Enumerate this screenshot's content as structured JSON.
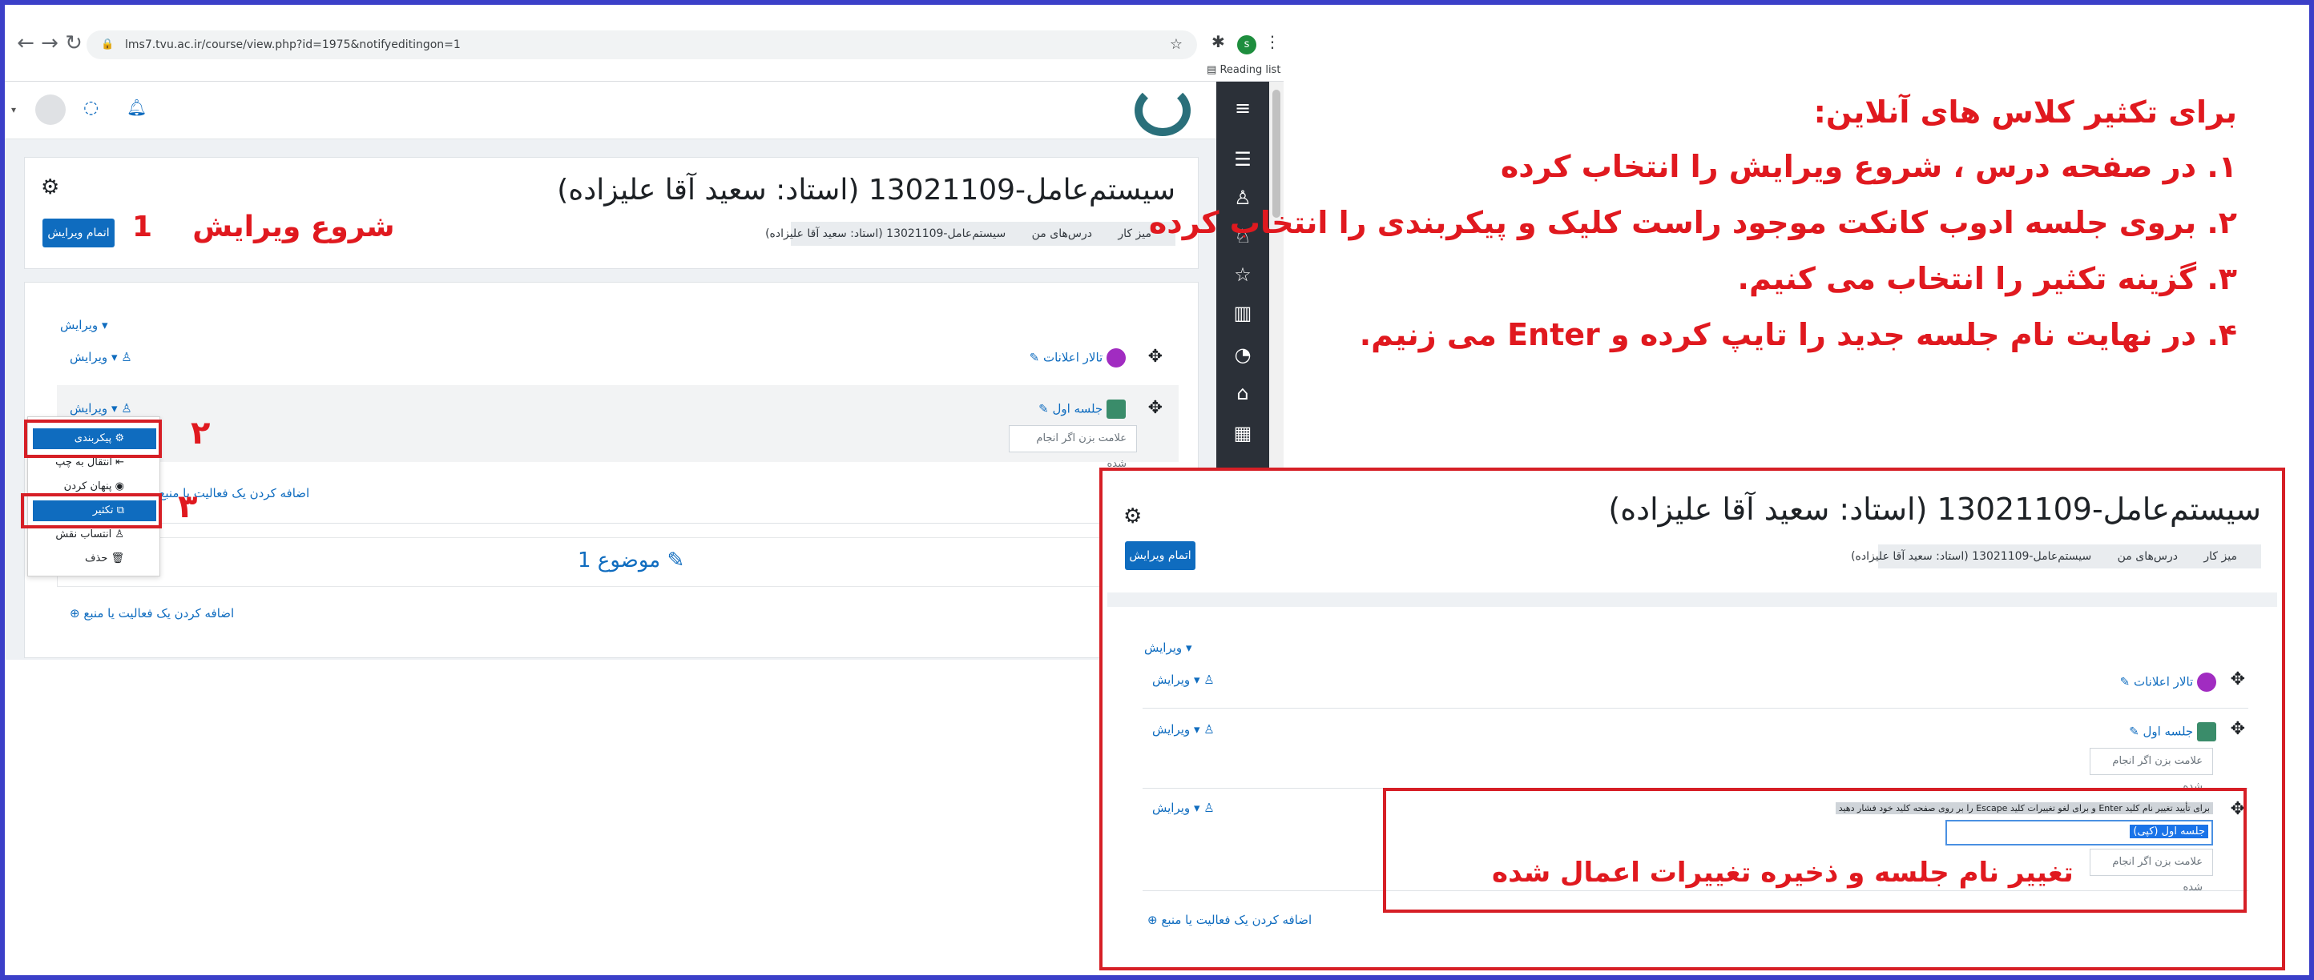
{
  "browser": {
    "url": "lms7.tvu.ac.ir/course/view.php?id=1975&notifyeditingon=1",
    "reading_list": "Reading list",
    "profile_initial": "s"
  },
  "course": {
    "title": "سیستم‌عامل-13021109 (استاد: سعید آقا علیزاده)",
    "breadcrumb": [
      "میز کار",
      "درس‌های من",
      "سیستم‌عامل-13021109 (استاد: سعید آقا علیزاده)"
    ],
    "editing_button": "اتمام ویرایش",
    "edit_label": "ویرایش",
    "forum_name": "تالار اعلانات",
    "session_name": "جلسه اول",
    "mark_done": "علامت بزن اگر انجام شده",
    "add_activity": "اضافه کردن یک فعالیت یا منبع",
    "topic_title": "موضوع 1"
  },
  "context_menu": {
    "items": [
      "پیکربندی",
      "انتقال به چپ",
      "پنهان کردن",
      "تکثیر",
      "انتساب نقش",
      "حذف"
    ]
  },
  "annotations": {
    "step1_number": "1",
    "step1_label": "شروع ویرایش",
    "step2_number": "٢",
    "step3_number": "٣",
    "rename_hint": "برای تأیید تغییر نام کلید Enter و برای لغو تغییرات کلید Escape را بر روی صفحه کلید خود فشار دهید",
    "rename_value": "جلسه اول (کپی)",
    "rename_caption": "تغییر نام جلسه و ذخیره تغییرات اعمال شده"
  },
  "instructions": {
    "heading": "برای تکثیر کلاس های آنلاین:",
    "steps": [
      "١. در صفحه درس ، شروع ویرایش را انتخاب کرده",
      "٢. بروی جلسه ادوب کانکت موجود راست کلیک و پیکربندی را انتخاب کرده",
      "٣. گزینه تکثیر را انتخاب می کنیم.",
      "۴. در نهایت نام جلسه جدید را تایپ کرده و Enter می زنیم."
    ]
  },
  "colors": {
    "accent": "#0f6cbf",
    "annotation": "#e0191f",
    "frame": "#3b3fc8",
    "drawer": "#2b3038"
  }
}
